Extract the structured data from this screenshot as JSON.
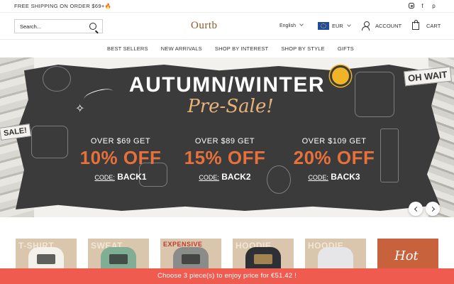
{
  "topbar": {
    "promo_text": "FREE SHIPPING ON ORDER $69+",
    "promo_emoji": "🔥",
    "social": [
      {
        "icon": "instagram-icon"
      },
      {
        "icon": "facebook-icon",
        "glyph": "f"
      },
      {
        "icon": "pinterest-icon",
        "glyph": "p"
      }
    ]
  },
  "header": {
    "search_placeholder": "Search...",
    "logo": "Ourtb",
    "language": "English",
    "currency": "EUR",
    "account_label": "ACCOUNT",
    "cart_label": "CART"
  },
  "nav": {
    "items": [
      "BEST SELLERS",
      "NEW ARRIVALS",
      "SHOP BY INTEREST",
      "SHOP BY STYLE",
      "GIFTS"
    ]
  },
  "hero": {
    "headline": "AUTUMN/WINTER",
    "subline": "Pre-Sale!",
    "stickers": {
      "left": "SALE!",
      "right": "OH WAIT"
    },
    "offers": [
      {
        "over": "OVER $69 GET",
        "off": "10% OFF",
        "code_label": "CODE:",
        "code": "BACK1"
      },
      {
        "over": "OVER $89 GET",
        "off": "15% OFF",
        "code_label": "CODE:",
        "code": "BACK2"
      },
      {
        "over": "OVER $109 GET",
        "off": "20% OFF",
        "code_label": "CODE:",
        "code": "BACK3"
      }
    ],
    "colors": {
      "panel": "#3b3b3b",
      "accent_orange": "#e8703a",
      "accent_gold": "#e3a42b",
      "script": "#e7b37a"
    }
  },
  "products": {
    "tiles": [
      {
        "tag": "T-SHIRT",
        "color": "#f4f1ea"
      },
      {
        "tag": "SWEAT",
        "color": "#7fae94"
      },
      {
        "tag": "EXPENSIVE",
        "color": "#8a8c8a"
      },
      {
        "tag": "HOODIE",
        "color": "#2e3036"
      },
      {
        "tag": "HOODIE",
        "color": "#e6e6e8"
      },
      {
        "tag": "",
        "label": "Hot",
        "color": "#c8623d"
      }
    ]
  },
  "bottom_bar": {
    "text": "Choose 3 piece(s) to enjoy price for €51.42 !",
    "color": "#ef5b4f"
  }
}
